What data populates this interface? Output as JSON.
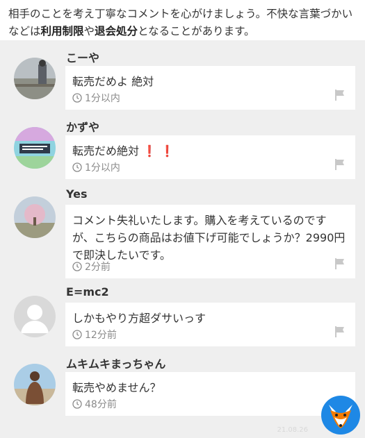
{
  "notice": {
    "part1": "相手のことを考え丁寧なコメントを心がけましょう。不快な言葉づかいなどは",
    "bold1": "利用制限",
    "part2": "や",
    "bold2": "退会処分",
    "part3": "となることがあります。"
  },
  "comments": [
    {
      "name": "こーや",
      "text": "転売だめよ 絶対",
      "time": "1分以内"
    },
    {
      "name": "かずや",
      "text": "転売だめ絶対",
      "emoji": "❗ ❗",
      "time": "1分以内"
    },
    {
      "name": "Yes",
      "text": "コメント失礼いたします。購入を考えているのですが、こちらの商品はお値下げ可能でしょうか？2990円で即決したいです。",
      "time": "2分前"
    },
    {
      "name": "E=mc2",
      "text": "しかもやり方超ダサいっす",
      "time": "12分前"
    },
    {
      "name": "ムキムキまっちゃん",
      "text": "転売やめません？",
      "time": "48分前"
    }
  ],
  "watermark": {
    "left": "",
    "right": "21.08.26"
  },
  "colors": {
    "background": "#efefef",
    "bubble": "#ffffff",
    "meta": "#8a8a8a",
    "accent_red": "#e53935"
  }
}
